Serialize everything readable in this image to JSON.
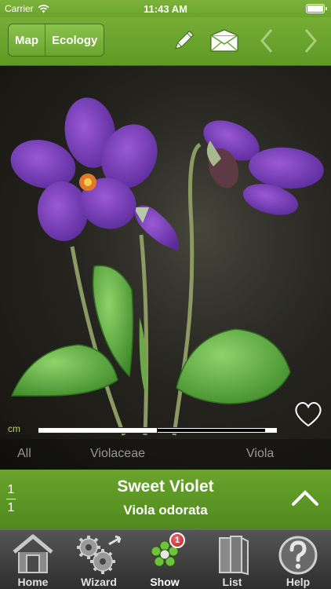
{
  "status_bar": {
    "carrier": "Carrier",
    "time": "11:43 AM"
  },
  "toolbar": {
    "segments": [
      "Map",
      "Ecology"
    ],
    "icons": [
      "pencil-icon",
      "envelope-icon",
      "chevron-left-icon",
      "chevron-right-icon"
    ]
  },
  "photo": {
    "scale_label": "cm",
    "breadcrumbs": [
      "All",
      "Violaceae",
      "Viola"
    ]
  },
  "species": {
    "counter_current": "1",
    "counter_total": "1",
    "common_name": "Sweet Violet",
    "latin_name": "Viola odorata"
  },
  "tabs": [
    {
      "label": "Home",
      "icon": "house-icon"
    },
    {
      "label": "Wizard",
      "icon": "gears-icon"
    },
    {
      "label": "Show",
      "icon": "flower-icon",
      "badge": "1"
    },
    {
      "label": "List",
      "icon": "books-icon"
    },
    {
      "label": "Help",
      "icon": "question-icon"
    }
  ],
  "colors": {
    "accent_green": "#6aa42d",
    "flower_purple": "#7b3fb8",
    "tabbar": "#3a3a3a"
  }
}
